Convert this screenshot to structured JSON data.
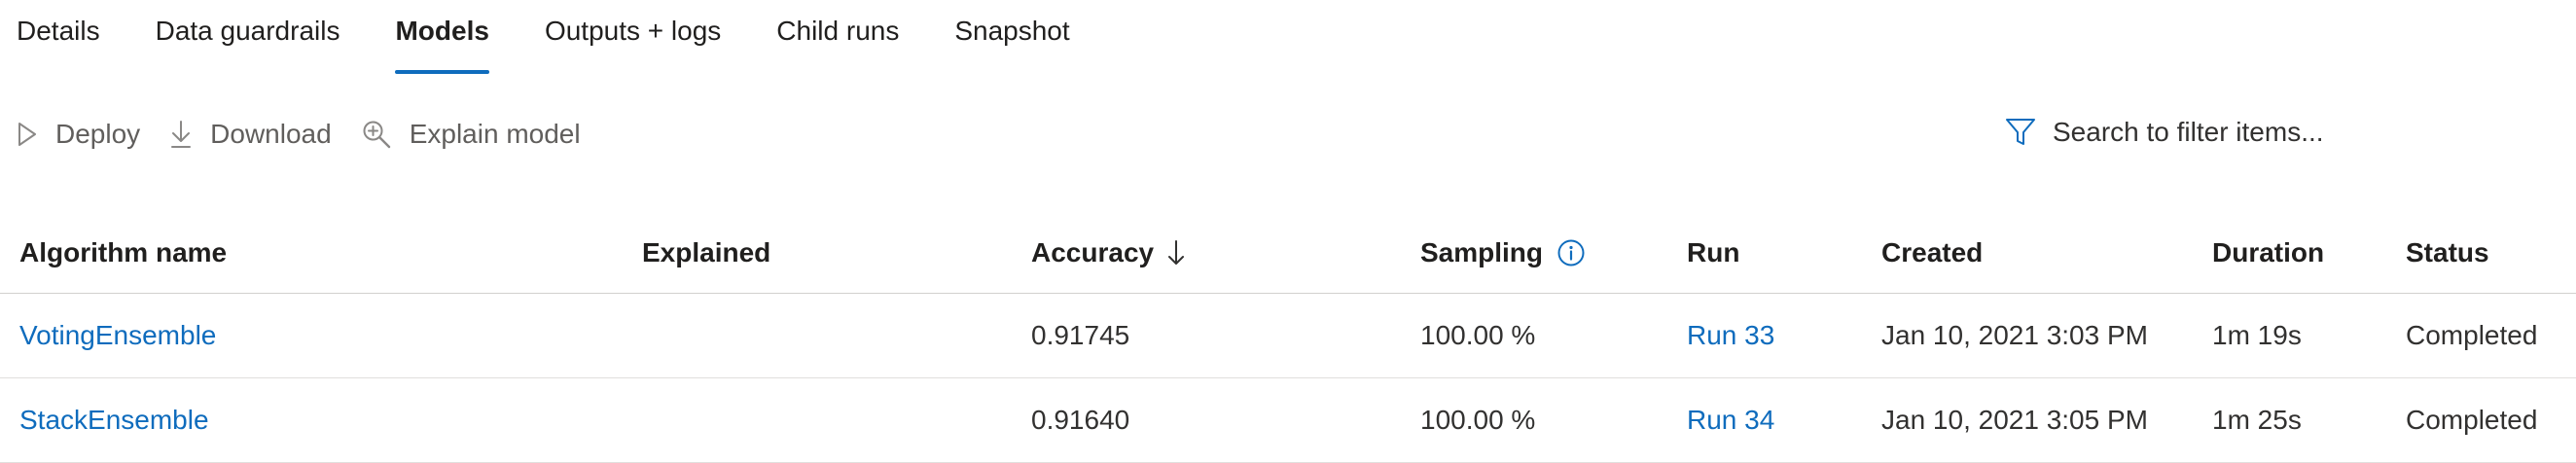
{
  "tabs": [
    {
      "label": "Details",
      "active": false
    },
    {
      "label": "Data guardrails",
      "active": false
    },
    {
      "label": "Models",
      "active": true
    },
    {
      "label": "Outputs + logs",
      "active": false
    },
    {
      "label": "Child runs",
      "active": false
    },
    {
      "label": "Snapshot",
      "active": false
    }
  ],
  "toolbar": {
    "deploy_label": "Deploy",
    "download_label": "Download",
    "explain_label": "Explain model",
    "deploy_icon": "play-icon",
    "download_icon": "download-icon",
    "explain_icon": "zoom-in-icon"
  },
  "filter": {
    "placeholder": "Search to filter items...",
    "icon": "filter-icon"
  },
  "table": {
    "columns": {
      "algorithm": "Algorithm name",
      "explained": "Explained",
      "accuracy": "Accuracy",
      "sampling": "Sampling",
      "run": "Run",
      "created": "Created",
      "duration": "Duration",
      "status": "Status"
    },
    "sort": {
      "column": "accuracy",
      "direction": "descending"
    },
    "rows": [
      {
        "algorithm": "VotingEnsemble",
        "explained": "",
        "accuracy": "0.91745",
        "sampling": "100.00 %",
        "run": "Run 33",
        "created": "Jan 10, 2021 3:03 PM",
        "duration": "1m 19s",
        "status": "Completed"
      },
      {
        "algorithm": "StackEnsemble",
        "explained": "",
        "accuracy": "0.91640",
        "sampling": "100.00 %",
        "run": "Run 34",
        "created": "Jan 10, 2021 3:05 PM",
        "duration": "1m 25s",
        "status": "Completed"
      }
    ]
  },
  "colors": {
    "accent": "#0f6cbd",
    "text": "#201f1e",
    "muted": "#605e5c",
    "divider": "#e1dfdd"
  }
}
